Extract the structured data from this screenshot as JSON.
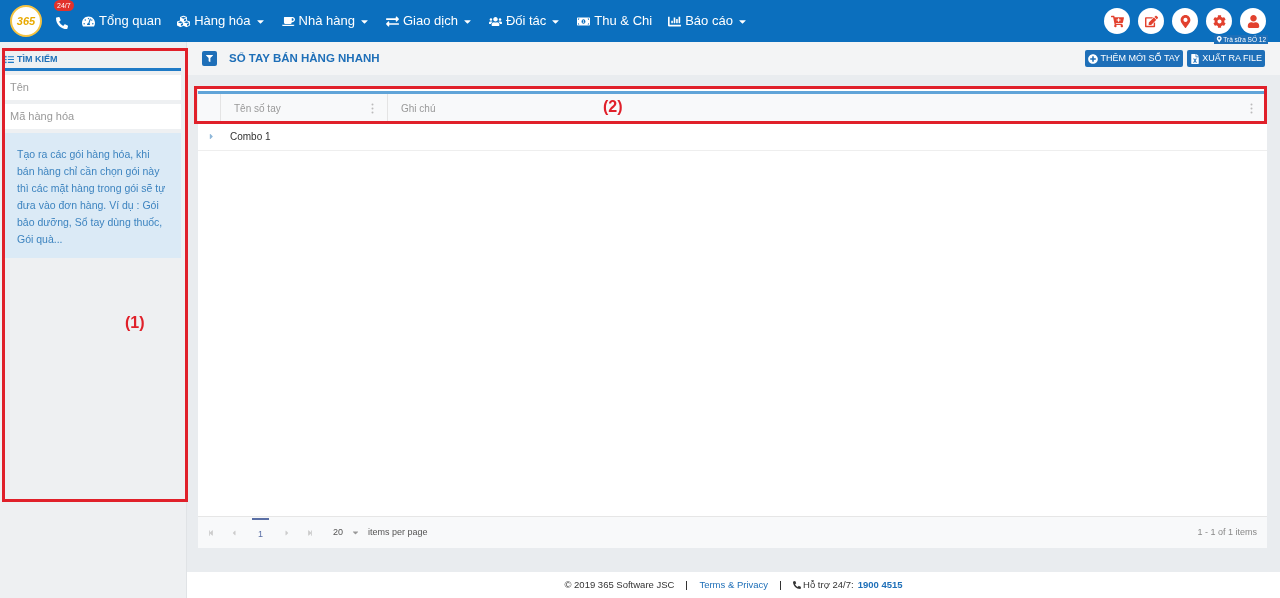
{
  "header": {
    "logo": "365",
    "hotline_badge": "24/7",
    "nav": [
      {
        "label": "Tổng quan",
        "dropdown": false
      },
      {
        "label": "Hàng hóa",
        "dropdown": true
      },
      {
        "label": "Nhà hàng",
        "dropdown": true
      },
      {
        "label": "Giao dịch",
        "dropdown": true
      },
      {
        "label": "Đối tác",
        "dropdown": true
      },
      {
        "label": "Thu & Chi",
        "dropdown": false
      },
      {
        "label": "Báo cáo",
        "dropdown": true
      }
    ],
    "store_tag": "Trà sữa SỐ 12"
  },
  "sidebar": {
    "title": "TÌM KIẾM",
    "fields": [
      {
        "placeholder": "Tên"
      },
      {
        "placeholder": "Mã hàng hóa"
      }
    ],
    "info": "Tạo ra các gói hàng hóa, khi bán hàng chỉ cần chọn gói này thì các mặt hàng trong gói sẽ tự đưa vào đơn hàng. Ví dụ : Gói bảo dưỡng, Sổ tay dùng thuốc, Gói quà..."
  },
  "page": {
    "title": "SỔ TAY BÁN HÀNG NHANH",
    "buttons": [
      {
        "label": "THÊM MỚI SỔ TAY"
      },
      {
        "label": "XUẤT RA FILE"
      }
    ]
  },
  "table": {
    "columns": [
      "Tên số tay",
      "Ghi chú"
    ],
    "rows": [
      {
        "name": "Combo 1"
      }
    ]
  },
  "pager": {
    "page": "1",
    "page_size": "20",
    "per_page_label": "items per page",
    "summary": "1 - 1 of 1 items"
  },
  "footer": {
    "copyright": "© 2019 365 Software JSC",
    "link": "Terms & Privacy",
    "support_label": "Hỗ trợ 24/7:",
    "phone": "1900 4515"
  },
  "annotations": [
    {
      "label": "(1)"
    },
    {
      "label": "(2)"
    }
  ]
}
